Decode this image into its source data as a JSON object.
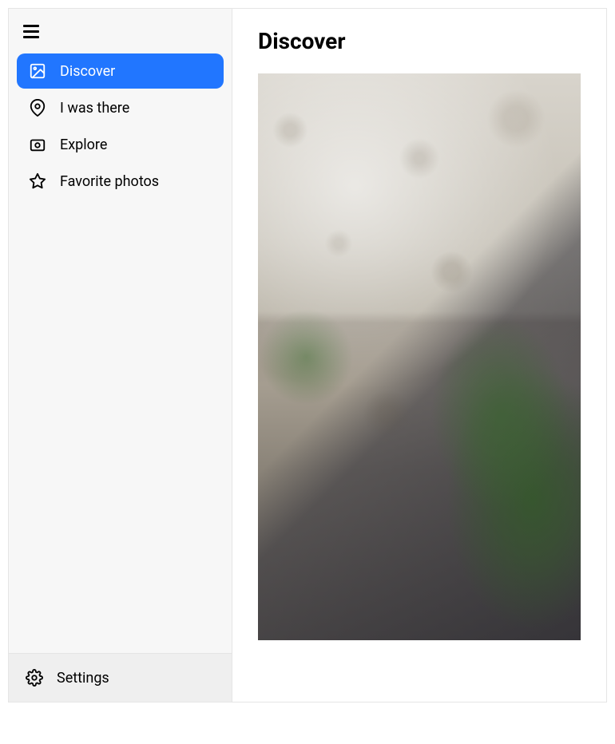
{
  "sidebar": {
    "nav_items": [
      {
        "label": "Discover",
        "icon": "image",
        "active": true
      },
      {
        "label": "I was there",
        "icon": "map-pin",
        "active": false
      },
      {
        "label": "Explore",
        "icon": "camera",
        "active": false
      },
      {
        "label": "Favorite photos",
        "icon": "star",
        "active": false
      }
    ],
    "footer": {
      "label": "Settings",
      "icon": "gear"
    }
  },
  "main": {
    "title": "Discover"
  }
}
